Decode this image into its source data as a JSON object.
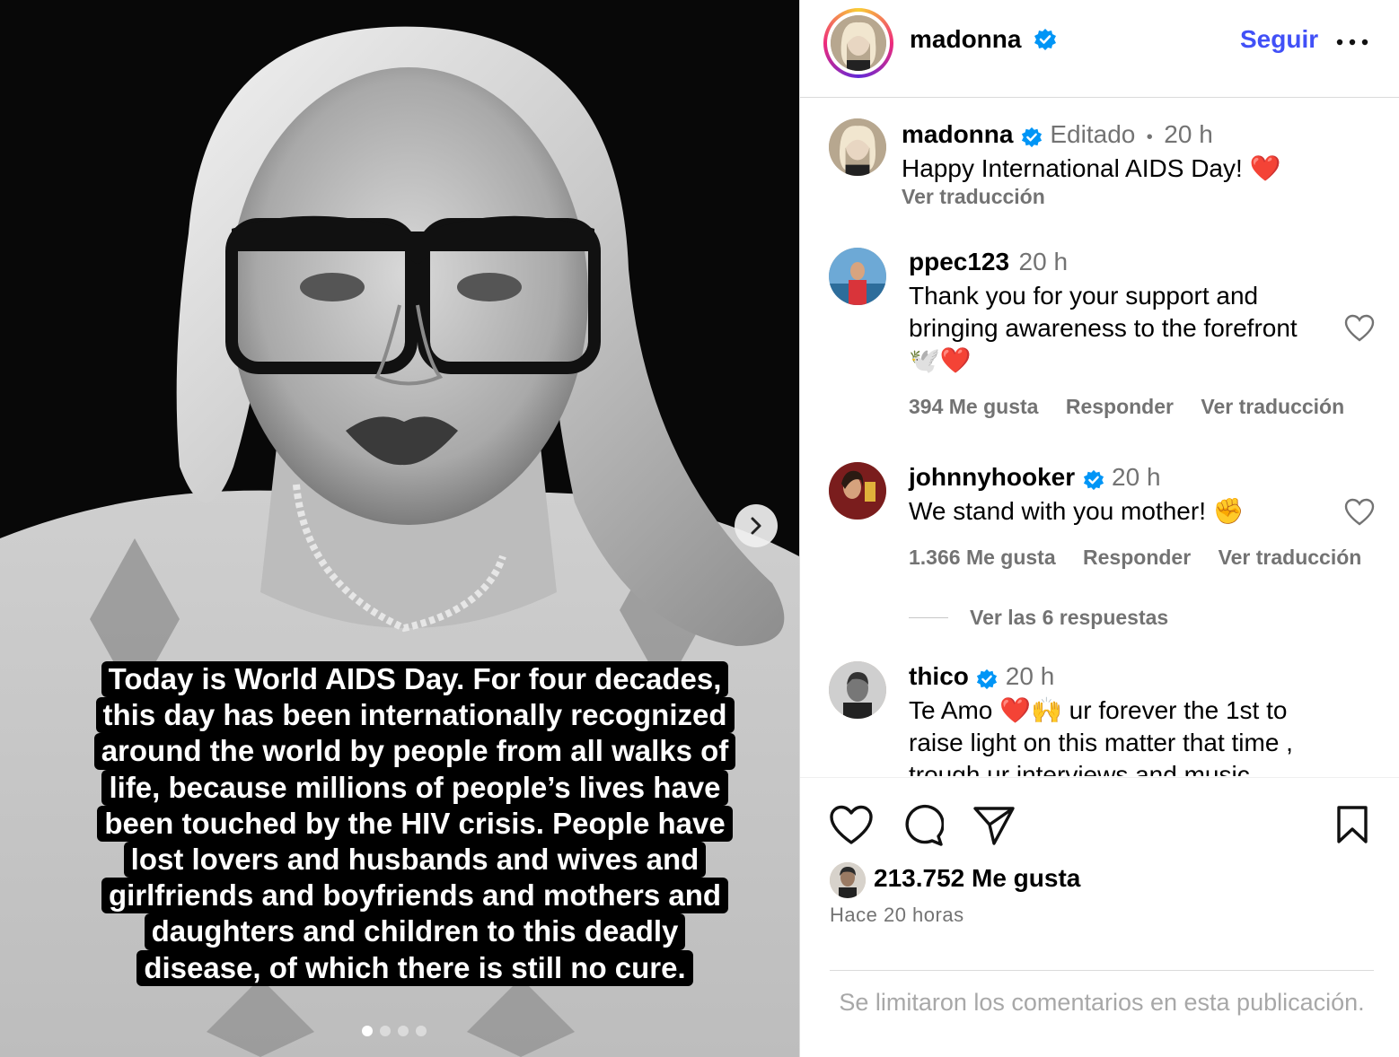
{
  "post": {
    "image_alt": "Black and white portrait of a woman with glasses",
    "caption_overlay": [
      "Today is World AIDS Day. For four decades,",
      "this day has been internationally recognized",
      "around the world by people from all walks of",
      "life, because millions of people’s lives have",
      "been touched by the HIV crisis. People have",
      "lost lovers and husbands and wives and",
      "girlfriends and boyfriends and mothers and",
      "daughters and children to this deadly",
      "disease, of which there is still no cure."
    ],
    "carousel": {
      "count": 4,
      "active": 1
    }
  },
  "header": {
    "username": "madonna",
    "follow_label": "Seguir",
    "more_label": "•••"
  },
  "caption": {
    "username": "madonna",
    "edited": "Editado",
    "separator": "•",
    "time": "20 h",
    "text": "Happy International  AIDS Day! ❤️",
    "translate": "Ver traducción"
  },
  "comments": [
    {
      "username": "ppec123",
      "verified": false,
      "time": "20 h",
      "lines": [
        "Thank you for your support and",
        "bringing awareness to the forefront",
        "🕊️❤️"
      ],
      "likes": "394 Me gusta",
      "reply": "Responder",
      "translate": "Ver traducción"
    },
    {
      "username": "johnnyhooker",
      "verified": true,
      "time": "20 h",
      "lines": [
        "We stand with you mother! ✊"
      ],
      "likes": "1.366 Me gusta",
      "reply": "Responder",
      "translate": "Ver traducción",
      "replies_label": "Ver las 6 respuestas"
    },
    {
      "username": "thico",
      "verified": true,
      "time": "20 h",
      "lines": [
        "Te Amo ❤️🙌 ur forever the 1st to",
        "raise light on this matter that time ,",
        "trough ur interviews and music"
      ]
    }
  ],
  "footer": {
    "likes": "213.752 Me gusta",
    "timestamp": "Hace 20 horas",
    "limited": "Se limitaron los comentarios en esta publicación."
  },
  "colors": {
    "link_blue": "#4150f7",
    "verified_blue": "#0095f6",
    "muted": "#737373"
  }
}
